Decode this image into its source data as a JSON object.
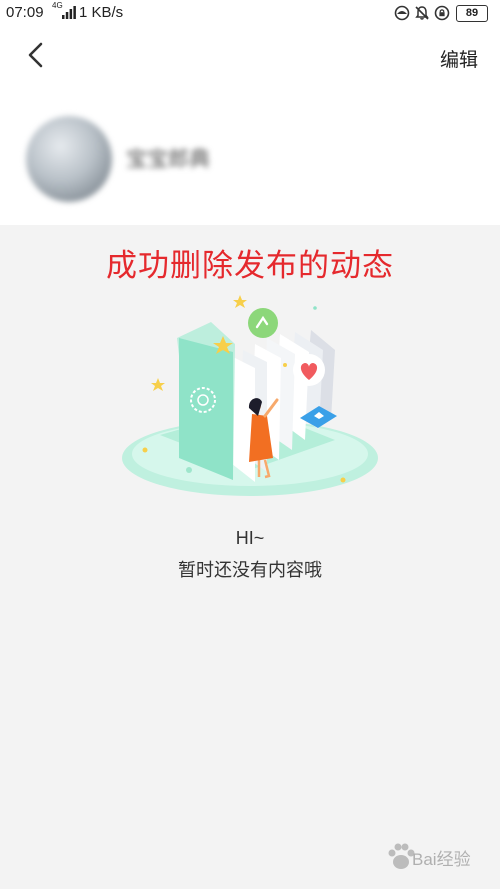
{
  "status_bar": {
    "time": "07:09",
    "network": "4G",
    "speed": "1 KB/s",
    "battery": "89",
    "icons": [
      "data-saver-icon",
      "bell-off-icon",
      "rotation-lock-icon",
      "battery-icon"
    ]
  },
  "header": {
    "back_icon": "chevron-left-icon",
    "edit_label": "编辑"
  },
  "profile": {
    "username": "宝宝郎典"
  },
  "annotation": "成功删除发布的动态",
  "empty_state": {
    "illustration": "open-book-girl-illustration",
    "greeting": "HI~",
    "message": "暂时还没有内容哦"
  },
  "colors": {
    "annotation_red": "#e5292d",
    "book_green": "#8fe3c8",
    "page_background": "#f3f3f3"
  },
  "watermark": "Bai经验"
}
